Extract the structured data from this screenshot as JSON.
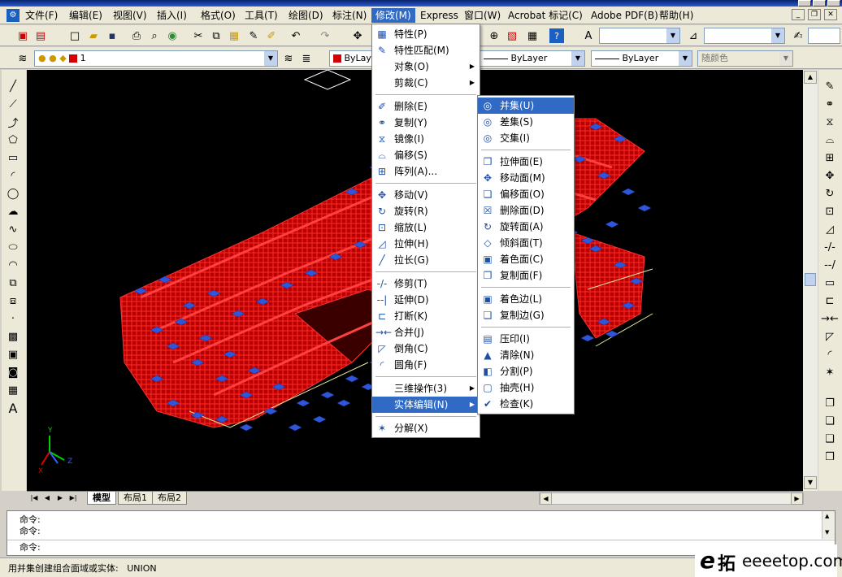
{
  "menubar": {
    "items": [
      "文件(F)",
      "编辑(E)",
      "视图(V)",
      "插入(I)",
      "格式(O)",
      "工具(T)",
      "绘图(D)",
      "标注(N)",
      "修改(M)",
      "Express",
      "窗口(W)",
      "Acrobat 标记(C)",
      "Adobe PDF(B)",
      "帮助(H)"
    ],
    "active_index": 8
  },
  "layer_toolbar": {
    "layer_value": "1"
  },
  "properties_toolbar": {
    "color": "ByLayer",
    "linetype": "ByLayer",
    "lineweight": "ByLayer",
    "plotstyle": "随颜色"
  },
  "modify_menu": {
    "items": [
      {
        "label": "特性(P)",
        "icon": "properties-icon"
      },
      {
        "label": "特性匹配(M)",
        "icon": "match-brush-icon"
      },
      {
        "label": "对象(O)",
        "submenu": true
      },
      {
        "label": "剪裁(C)",
        "submenu": true
      },
      {
        "label": "删除(E)",
        "icon": "erase-icon"
      },
      {
        "label": "复制(Y)",
        "icon": "copy-icon"
      },
      {
        "label": "镜像(I)",
        "icon": "mirror-icon"
      },
      {
        "label": "偏移(S)",
        "icon": "offset-icon"
      },
      {
        "label": "阵列(A)...",
        "icon": "array-icon"
      },
      {
        "label": "移动(V)",
        "icon": "move-icon"
      },
      {
        "label": "旋转(R)",
        "icon": "rotate-icon"
      },
      {
        "label": "缩放(L)",
        "icon": "scale-icon"
      },
      {
        "label": "拉伸(H)",
        "icon": "stretch-icon"
      },
      {
        "label": "拉长(G)",
        "icon": "lengthen-icon"
      },
      {
        "label": "修剪(T)",
        "icon": "trim-icon"
      },
      {
        "label": "延伸(D)",
        "icon": "extend-icon"
      },
      {
        "label": "打断(K)",
        "icon": "break-icon"
      },
      {
        "label": "合并(J)",
        "icon": "join-icon"
      },
      {
        "label": "倒角(C)",
        "icon": "chamfer-icon"
      },
      {
        "label": "圆角(F)",
        "icon": "fillet-icon"
      },
      {
        "label": "三维操作(3)",
        "submenu": true
      },
      {
        "label": "实体编辑(N)",
        "submenu": true,
        "highlight": true
      },
      {
        "label": "分解(X)",
        "icon": "explode-icon"
      }
    ]
  },
  "solid_menu": {
    "items": [
      {
        "label": "并集(U)",
        "icon": "union-icon",
        "highlight": true
      },
      {
        "label": "差集(S)",
        "icon": "subtract-icon"
      },
      {
        "label": "交集(I)",
        "icon": "intersect-icon"
      },
      {
        "label": "拉伸面(E)",
        "icon": "extrude-face-icon"
      },
      {
        "label": "移动面(M)",
        "icon": "move-face-icon"
      },
      {
        "label": "偏移面(O)",
        "icon": "offset-face-icon"
      },
      {
        "label": "删除面(D)",
        "icon": "delete-face-icon"
      },
      {
        "label": "旋转面(A)",
        "icon": "rotate-face-icon"
      },
      {
        "label": "倾斜面(T)",
        "icon": "taper-face-icon"
      },
      {
        "label": "着色面(C)",
        "icon": "color-face-icon"
      },
      {
        "label": "复制面(F)",
        "icon": "copy-face-icon"
      },
      {
        "label": "着色边(L)",
        "icon": "color-edge-icon"
      },
      {
        "label": "复制边(G)",
        "icon": "copy-edge-icon"
      },
      {
        "label": "压印(I)",
        "icon": "imprint-icon"
      },
      {
        "label": "清除(N)",
        "icon": "clean-icon"
      },
      {
        "label": "分割(P)",
        "icon": "separate-icon"
      },
      {
        "label": "抽壳(H)",
        "icon": "shell-icon"
      },
      {
        "label": "检查(K)",
        "icon": "check-icon"
      }
    ]
  },
  "tabs": [
    "模型",
    "布局1",
    "布局2"
  ],
  "command": {
    "lines": [
      "命令:",
      "命令:",
      "命令:"
    ]
  },
  "status": {
    "text": "用并集创建组合面域或实体:   UNION"
  },
  "watermark": {
    "text": "eeeetop.com"
  },
  "ucs": {
    "x": "X",
    "y": "Y",
    "z": "Z"
  },
  "colors": {
    "highlight": "#316ac5",
    "model_red": "#d40000",
    "model_blue": "#2f56d8"
  }
}
